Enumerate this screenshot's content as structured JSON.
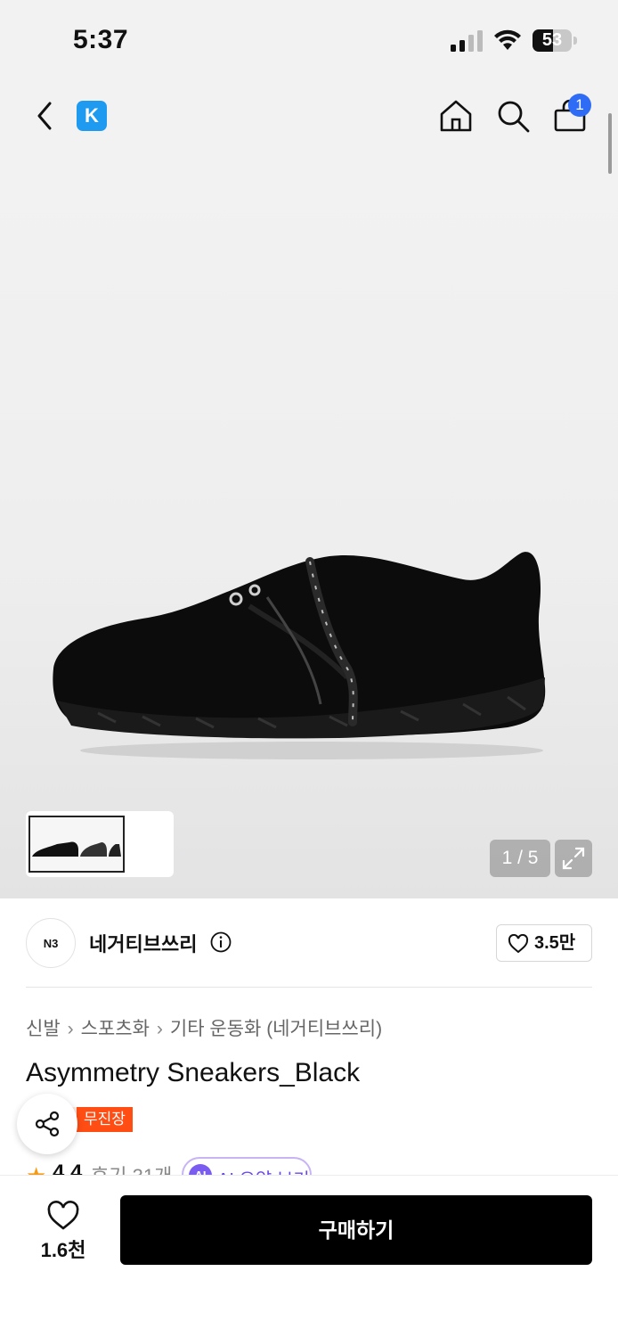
{
  "status_bar": {
    "time": "5:37",
    "battery": "53",
    "battery_level": 0.53
  },
  "nav": {
    "logo": "K",
    "cart_badge": "1"
  },
  "gallery": {
    "counter": "1 / 5"
  },
  "brand": {
    "logo_text": "N3",
    "name": "네거티브쓰리",
    "likes": "3.5만"
  },
  "product": {
    "breadcrumb": [
      "신발",
      "스포츠화",
      "기타 운동화 (네거티브쓰리)"
    ],
    "title": "Asymmetry Sneakers_Black",
    "badge": "무진장",
    "rating": "4.4",
    "reviews": "후기 31개",
    "ai_summary": "AI 요약 보기",
    "ai_label": "AI"
  },
  "bottom": {
    "wish_count": "1.6천",
    "buy_label": "구매하기"
  },
  "colors": {
    "accent_blue": "#2f6cf6",
    "logo_blue": "#1e9bf0",
    "badge_orange": "#ff4d14",
    "ai_purple": "#7b5cf0"
  }
}
